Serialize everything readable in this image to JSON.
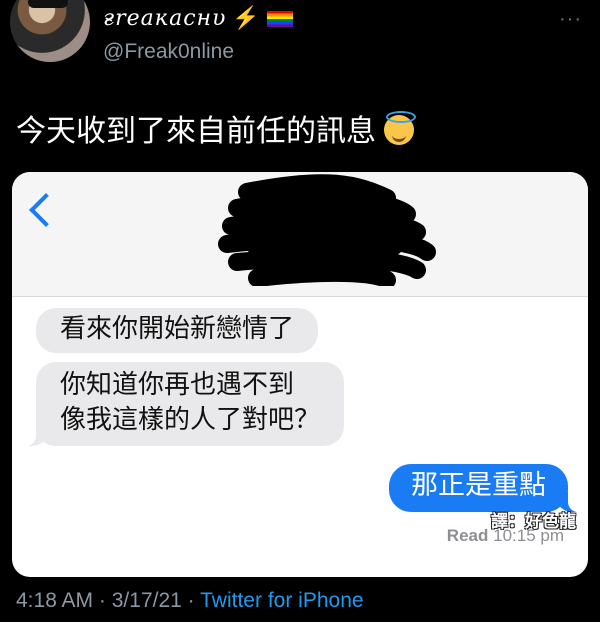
{
  "tweet": {
    "display_name": "ғreaĸacнυ",
    "handle": "@Freak0nline",
    "text": "今天收到了來自前任的訊息",
    "timestamp": "4:18 AM",
    "date": "3/17/21",
    "separator": "·",
    "source": "Twitter for iPhone",
    "more_icon": "···"
  },
  "screenshot": {
    "messages": [
      {
        "from": "them",
        "text": "看來你開始新戀情了"
      },
      {
        "from": "them",
        "text": "你知道你再也遇不到\n像我這樣的人了對吧？"
      },
      {
        "from": "me",
        "text": "那正是重點"
      }
    ],
    "watermark": "譯：好色龍",
    "read_label": "Read",
    "read_time": "10:15 pm"
  },
  "colors": {
    "imessage_blue": "#1a7cf5",
    "received_gray": "#e9e9eb",
    "twitter_blue": "#1d9bf0",
    "muted": "#8b98a5"
  }
}
